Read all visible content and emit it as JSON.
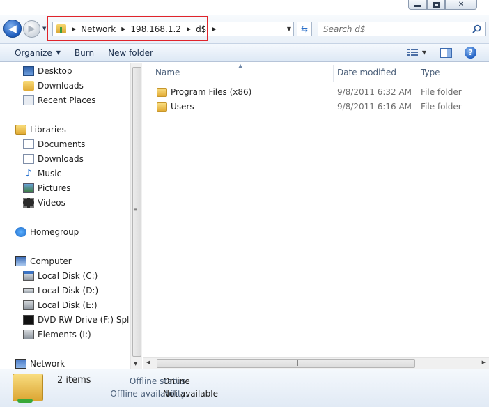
{
  "window": {
    "caption_buttons": {
      "minimize": "minimize-icon",
      "maximize": "maximize-icon",
      "close": "close-icon"
    }
  },
  "address_bar": {
    "breadcrumbs": [
      "Network",
      "198.168.1.2",
      "d$"
    ],
    "search_placeholder": "Search d$",
    "highlight_color": "#e0242b"
  },
  "toolbar": {
    "organize_label": "Organize",
    "burn_label": "Burn",
    "new_folder_label": "New folder"
  },
  "nav_pane": {
    "favorites": [
      {
        "label": "Desktop",
        "icon": "desktop-icon"
      },
      {
        "label": "Downloads",
        "icon": "folder-icon"
      },
      {
        "label": "Recent Places",
        "icon": "recent-places-icon"
      }
    ],
    "libraries": {
      "label": "Libraries",
      "items": [
        {
          "label": "Documents",
          "icon": "documents-icon"
        },
        {
          "label": "Downloads",
          "icon": "folder-icon"
        },
        {
          "label": "Music",
          "icon": "music-icon"
        },
        {
          "label": "Pictures",
          "icon": "pictures-icon"
        },
        {
          "label": "Videos",
          "icon": "videos-icon"
        }
      ]
    },
    "homegroup": {
      "label": "Homegroup"
    },
    "computer": {
      "label": "Computer",
      "items": [
        {
          "label": "Local Disk (C:)",
          "icon": "local-disk-c-icon"
        },
        {
          "label": "Local Disk (D:)",
          "icon": "local-disk-icon"
        },
        {
          "label": "Local Disk (E:)",
          "icon": "local-disk-icon"
        },
        {
          "label": "DVD RW Drive (F:) Split/S",
          "icon": "dvd-drive-icon"
        },
        {
          "label": "Elements (I:)",
          "icon": "external-disk-icon"
        }
      ]
    },
    "network": {
      "label": "Network"
    }
  },
  "content": {
    "columns": {
      "name": "Name",
      "date_modified": "Date modified",
      "type": "Type"
    },
    "rows": [
      {
        "name": "Program Files (x86)",
        "date_modified": "9/8/2011 6:32 AM",
        "type": "File folder"
      },
      {
        "name": "Users",
        "date_modified": "9/8/2011 6:16 AM",
        "type": "File folder"
      }
    ]
  },
  "details": {
    "item_count": "2 items",
    "offline_status_label": "Offline status:",
    "offline_status_value": "Online",
    "offline_availability_label": "Offline availability:",
    "offline_availability_value": "Not available"
  }
}
